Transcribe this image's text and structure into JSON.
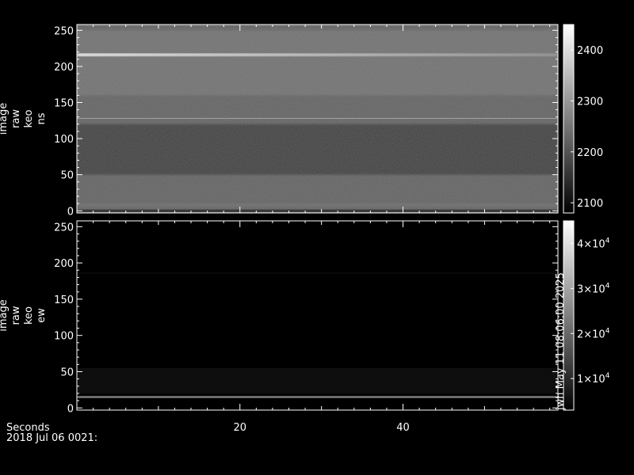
{
  "chart_data": [
    {
      "type": "heatmap",
      "name": "ns",
      "ylabel_lines": [
        "image",
        "raw",
        "keo",
        "ns"
      ],
      "xlim": [
        0,
        59
      ],
      "ylim": [
        -3,
        258
      ],
      "yticks": [
        0,
        50,
        100,
        150,
        200,
        250
      ],
      "colorbar": {
        "range": [
          2080,
          2450
        ],
        "ticks": [
          2100,
          2200,
          2300,
          2400
        ],
        "tick_labels": [
          "2100",
          "2200",
          "2300",
          "2400"
        ]
      },
      "bands": [
        {
          "y": 216,
          "value": 2430,
          "fade_to": 2300,
          "width": 4
        },
        {
          "y": 128,
          "value": 2320,
          "width": 1
        },
        {
          "y": 8,
          "value": 2250,
          "width": 5
        },
        {
          "y": 0,
          "value": 2120,
          "width": 3
        }
      ]
    },
    {
      "type": "heatmap",
      "name": "ew",
      "ylabel_lines": [
        "image",
        "raw",
        "keo",
        "ew"
      ],
      "xlim": [
        0,
        59
      ],
      "ylim": [
        -3,
        258
      ],
      "yticks": [
        0,
        50,
        100,
        150,
        200,
        250
      ],
      "colorbar": {
        "range": [
          3000,
          45000
        ],
        "ticks": [
          10000,
          20000,
          30000,
          40000
        ],
        "tick_labels": [
          [
            "1×10",
            "4"
          ],
          [
            "2×10",
            "4"
          ],
          [
            "3×10",
            "4"
          ],
          [
            "4×10",
            "4"
          ]
        ]
      },
      "bands": [
        {
          "y": 15,
          "value": 42000,
          "width": 2
        },
        {
          "y": 186,
          "value": 6000,
          "width": 1
        }
      ]
    }
  ],
  "xaxis": {
    "label": "Seconds",
    "ticks": [
      20,
      40
    ]
  },
  "date_label": "2018 Jul 06 0021:",
  "side_stamp": "jwh May 11 08:06:00 2025"
}
